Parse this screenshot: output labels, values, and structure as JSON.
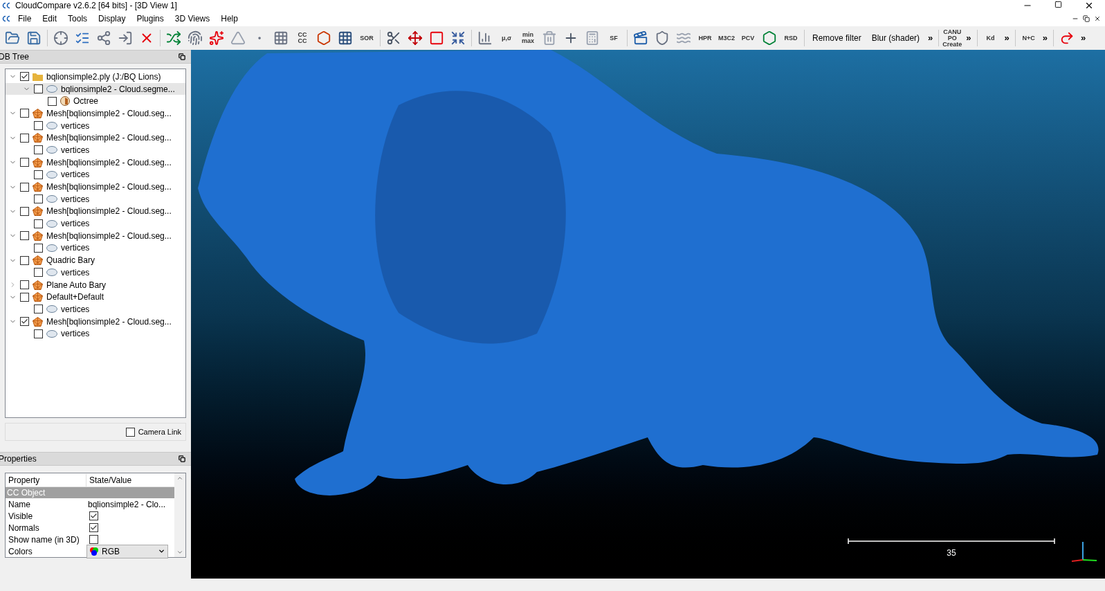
{
  "window": {
    "title": "CloudCompare v2.6.2 [64 bits] - [3D View 1]"
  },
  "menu": [
    "File",
    "Edit",
    "Tools",
    "Display",
    "Plugins",
    "3D Views",
    "Help"
  ],
  "toolbar": [
    {
      "kind": "glyph"
    },
    {
      "kind": "glyph"
    },
    {
      "kind": "separator"
    },
    {
      "kind": "glyph"
    },
    {
      "kind": "glyph"
    },
    {
      "kind": "glyph"
    },
    {
      "kind": "glyph"
    },
    {
      "kind": "glyph"
    },
    {
      "kind": "separator"
    },
    {
      "kind": "glyph"
    },
    {
      "kind": "glyph"
    },
    {
      "kind": "glyph"
    },
    {
      "kind": "glyph"
    },
    {
      "kind": "glyph"
    },
    {
      "kind": "glyph"
    },
    {
      "kind": "label",
      "label": "CC CC"
    },
    {
      "kind": "glyph"
    },
    {
      "kind": "glyph"
    },
    {
      "kind": "label",
      "label": "SOR"
    },
    {
      "kind": "separator"
    },
    {
      "kind": "glyph"
    },
    {
      "kind": "glyph"
    },
    {
      "kind": "glyph"
    },
    {
      "kind": "glyph"
    },
    {
      "kind": "separator"
    },
    {
      "kind": "glyph"
    },
    {
      "kind": "label",
      "label": "μ,σ"
    },
    {
      "kind": "label",
      "label": "min max"
    },
    {
      "kind": "glyph"
    },
    {
      "kind": "glyph"
    },
    {
      "kind": "glyph"
    },
    {
      "kind": "label",
      "label": "SF"
    },
    {
      "kind": "separator"
    },
    {
      "kind": "glyph"
    },
    {
      "kind": "glyph"
    },
    {
      "kind": "glyph"
    },
    {
      "kind": "label",
      "label": "HPR"
    },
    {
      "kind": "label",
      "label": "M3C2"
    },
    {
      "kind": "label",
      "label": "PCV"
    },
    {
      "kind": "glyph"
    },
    {
      "kind": "label",
      "label": "RSD"
    },
    {
      "kind": "separator"
    },
    {
      "kind": "text",
      "label": "Remove filter"
    },
    {
      "kind": "text",
      "label": "Blur (shader)"
    },
    {
      "kind": "overflow",
      "label": "»"
    },
    {
      "kind": "separator"
    },
    {
      "kind": "label",
      "label": "CANUPO Create"
    },
    {
      "kind": "overflow",
      "label": "»"
    },
    {
      "kind": "separator"
    },
    {
      "kind": "label",
      "label": "Kd"
    },
    {
      "kind": "overflow",
      "label": "»"
    },
    {
      "kind": "separator"
    },
    {
      "kind": "label",
      "label": "N+C"
    },
    {
      "kind": "overflow",
      "label": "»"
    },
    {
      "kind": "separator"
    },
    {
      "kind": "glyph"
    },
    {
      "kind": "overflow",
      "label": "»"
    }
  ],
  "db_tree": {
    "title": "DB Tree",
    "items": [
      {
        "kind": "folder",
        "label": "bqlionsimple2.ply (J:/BQ Lions)",
        "checked": true,
        "expanded": true,
        "selected": false,
        "children": [
          {
            "kind": "cloud",
            "label": "bqlionsimple2 - Cloud.segme...",
            "checked": false,
            "expanded": true,
            "selected": true,
            "children": [
              {
                "kind": "octree",
                "label": "Octree",
                "checked": false,
                "selected": false
              }
            ]
          }
        ]
      },
      {
        "kind": "mesh",
        "label": "Mesh[bqlionsimple2 - Cloud.seg...",
        "checked": false,
        "expanded": true,
        "selected": false,
        "children": [
          {
            "kind": "cloud",
            "label": "vertices",
            "checked": false,
            "selected": false
          }
        ]
      },
      {
        "kind": "mesh",
        "label": "Mesh[bqlionsimple2 - Cloud.seg...",
        "checked": false,
        "expanded": true,
        "selected": false,
        "children": [
          {
            "kind": "cloud",
            "label": "vertices",
            "checked": false,
            "selected": false
          }
        ]
      },
      {
        "kind": "mesh",
        "label": "Mesh[bqlionsimple2 - Cloud.seg...",
        "checked": false,
        "expanded": true,
        "selected": false,
        "children": [
          {
            "kind": "cloud",
            "label": "vertices",
            "checked": false,
            "selected": false
          }
        ]
      },
      {
        "kind": "mesh",
        "label": "Mesh[bqlionsimple2 - Cloud.seg...",
        "checked": false,
        "expanded": true,
        "selected": false,
        "children": [
          {
            "kind": "cloud",
            "label": "vertices",
            "checked": false,
            "selected": false
          }
        ]
      },
      {
        "kind": "mesh",
        "label": "Mesh[bqlionsimple2 - Cloud.seg...",
        "checked": false,
        "expanded": true,
        "selected": false,
        "children": [
          {
            "kind": "cloud",
            "label": "vertices",
            "checked": false,
            "selected": false
          }
        ]
      },
      {
        "kind": "mesh",
        "label": "Mesh[bqlionsimple2 - Cloud.seg...",
        "checked": false,
        "expanded": true,
        "selected": false,
        "children": [
          {
            "kind": "cloud",
            "label": "vertices",
            "checked": false,
            "selected": false
          }
        ]
      },
      {
        "kind": "mesh",
        "label": "Quadric Bary",
        "checked": false,
        "expanded": true,
        "selected": false,
        "children": [
          {
            "kind": "cloud",
            "label": "vertices",
            "checked": false,
            "selected": false
          }
        ]
      },
      {
        "kind": "mesh",
        "label": "Plane Auto Bary",
        "checked": false,
        "expanded": false,
        "selected": false
      },
      {
        "kind": "mesh",
        "label": "Default+Default",
        "checked": false,
        "expanded": true,
        "selected": false,
        "children": [
          {
            "kind": "cloud",
            "label": "vertices",
            "checked": false,
            "selected": false
          }
        ]
      },
      {
        "kind": "mesh",
        "label": "Mesh[bqlionsimple2 - Cloud.seg...",
        "checked": true,
        "expanded": true,
        "selected": false,
        "children": [
          {
            "kind": "cloud",
            "label": "vertices",
            "checked": false,
            "selected": false
          }
        ]
      }
    ]
  },
  "camera_link": {
    "label": "Camera Link",
    "checked": false
  },
  "properties": {
    "title": "Properties",
    "columns": [
      "Property",
      "State/Value"
    ],
    "section": "CC Object",
    "rows": [
      {
        "kind": "text",
        "name": "Name",
        "value": "bqlionsimple2 - Clo..."
      },
      {
        "kind": "check",
        "name": "Visible",
        "checked": true
      },
      {
        "kind": "check",
        "name": "Normals",
        "checked": true
      },
      {
        "kind": "check",
        "name": "Show name (in 3D)",
        "checked": false
      },
      {
        "kind": "combo",
        "name": "Colors",
        "value": "RGB"
      }
    ]
  },
  "view": {
    "scale_label": "35"
  }
}
